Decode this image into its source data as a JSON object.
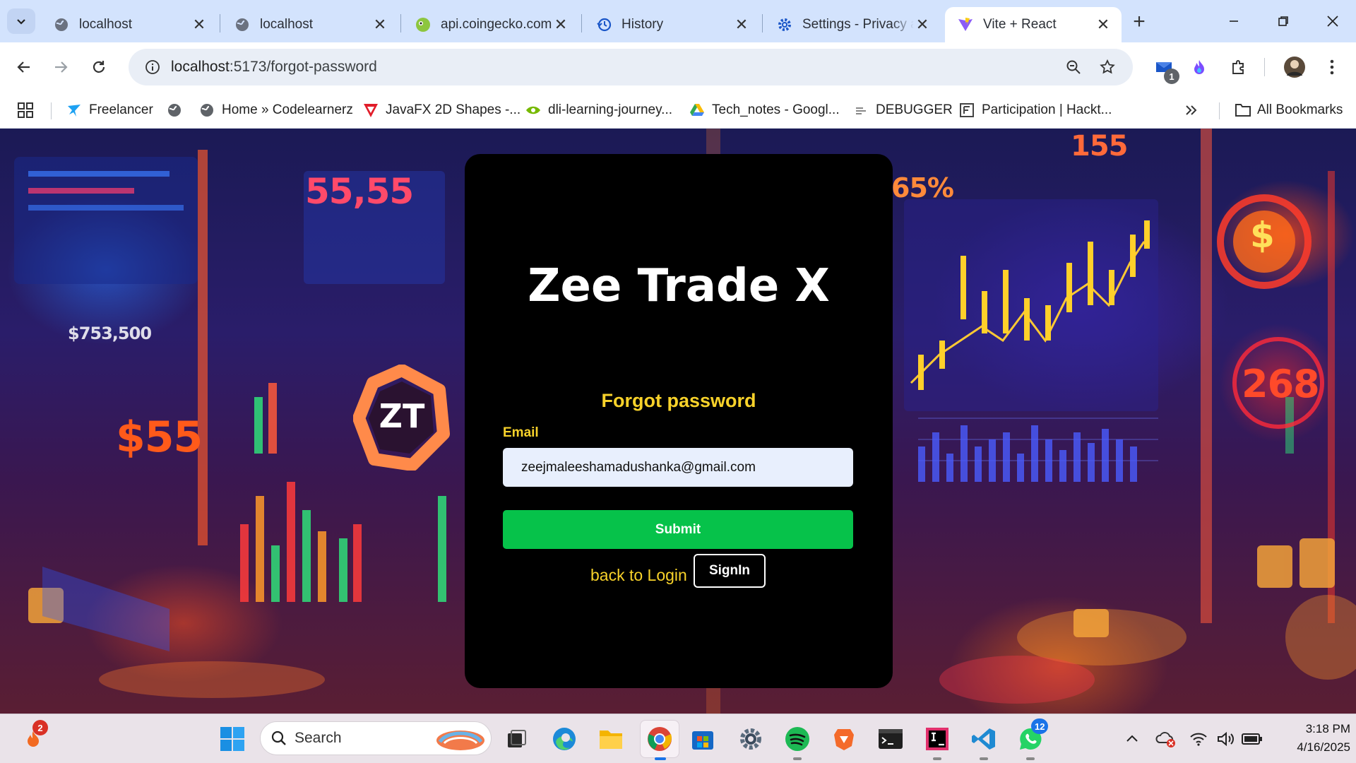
{
  "browser": {
    "tabs": [
      {
        "title": "localhost",
        "favicon": "globe-icon",
        "active": false
      },
      {
        "title": "localhost",
        "favicon": "globe-icon",
        "active": false
      },
      {
        "title": "api.coingecko.com",
        "favicon": "coingecko-icon",
        "active": false
      },
      {
        "title": "History",
        "favicon": "history-icon",
        "active": false
      },
      {
        "title": "Settings - Privacy a",
        "favicon": "gear-icon",
        "active": false
      },
      {
        "title": "Vite + React",
        "favicon": "vite-icon",
        "active": true
      }
    ],
    "url_host": "localhost",
    "url_path": ":5173/forgot-password",
    "extension_badge": "1",
    "bookmarks": [
      {
        "label": "Freelancer",
        "icon": "freelancer-icon"
      },
      {
        "label": "",
        "icon": "globe-icon"
      },
      {
        "label": "Home » Codelearnerz",
        "icon": "globe-icon"
      },
      {
        "label": "JavaFX 2D Shapes -...",
        "icon": "javafx-icon"
      },
      {
        "label": "dli-learning-journey...",
        "icon": "nvidia-icon"
      },
      {
        "label": "Tech_notes - Googl...",
        "icon": "drive-icon"
      },
      {
        "label": "DEBUGGER",
        "icon": "debugger-icon"
      },
      {
        "label": "Participation | Hackt...",
        "icon": "hackathon-icon"
      }
    ],
    "all_bookmarks_label": "All Bookmarks"
  },
  "page": {
    "brand": "Zee Trade X",
    "subtitle": "Forgot password",
    "email_label": "Email",
    "email_value": "zeejmaleeshamadushanka@gmail.com",
    "submit_label": "Submit",
    "back_to_login": "back to Login",
    "signin_label": "SignIn",
    "logo_text": "ZT",
    "background_figures": [
      "55,55",
      "$55",
      "268",
      "155",
      "65%",
      "$753,500",
      "$"
    ],
    "colors": {
      "accent": "#f8d22a",
      "submit": "#06c24a",
      "card": "#000000"
    }
  },
  "taskbar": {
    "weather_badge": "2",
    "search_label": "Search",
    "whatsapp_badge": "12",
    "time": "3:18 PM",
    "date": "4/16/2025"
  }
}
